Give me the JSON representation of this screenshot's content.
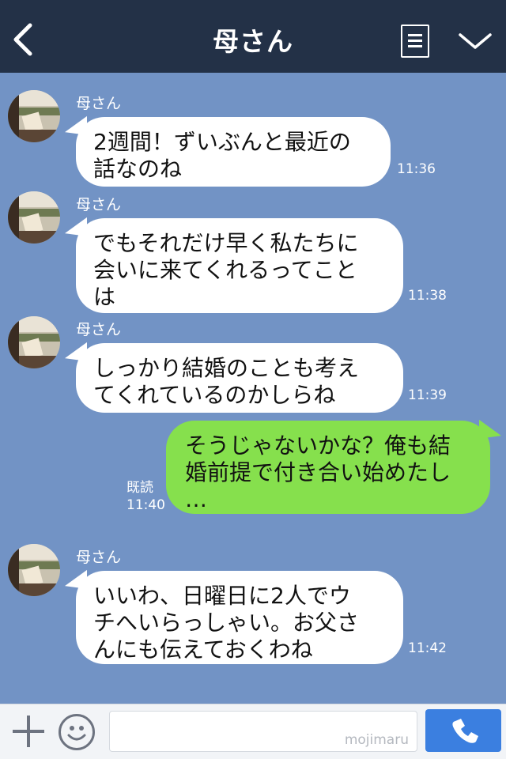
{
  "header": {
    "title": "母さん"
  },
  "messages": [
    {
      "sender": "母さん",
      "lines": [
        "2週間！ずいぶんと最近の",
        "話なのね"
      ],
      "time": "11:36"
    },
    {
      "sender": "母さん",
      "lines": [
        "でもそれだけ早く私たちに",
        "会いに来てくれるってこと",
        "は"
      ],
      "time": "11:38"
    },
    {
      "sender": "母さん",
      "lines": [
        "しっかり結婚のことも考え",
        "てくれているのかしらね"
      ],
      "time": "11:39"
    },
    {
      "lines": [
        "そうじゃないかな？俺も結",
        "婚前提で付き合い始めたし",
        "…"
      ],
      "read": "既読",
      "time": "11:40"
    },
    {
      "sender": "母さん",
      "lines": [
        "いいわ、日曜日に2人でウ",
        "チへいらっしゃい。お父さ",
        "んにも伝えておくわね"
      ],
      "time": "11:42"
    }
  ],
  "footer": {
    "watermark": "mojimaru"
  },
  "colors": {
    "header_bg": "#233147",
    "chat_bg": "#7293c5",
    "outgoing_bubble": "#86e04d",
    "call_button": "#3b7fe0"
  },
  "icons": [
    "back-icon",
    "menu-icon",
    "chevron-down-icon",
    "plus-icon",
    "emoji-icon",
    "phone-icon"
  ]
}
